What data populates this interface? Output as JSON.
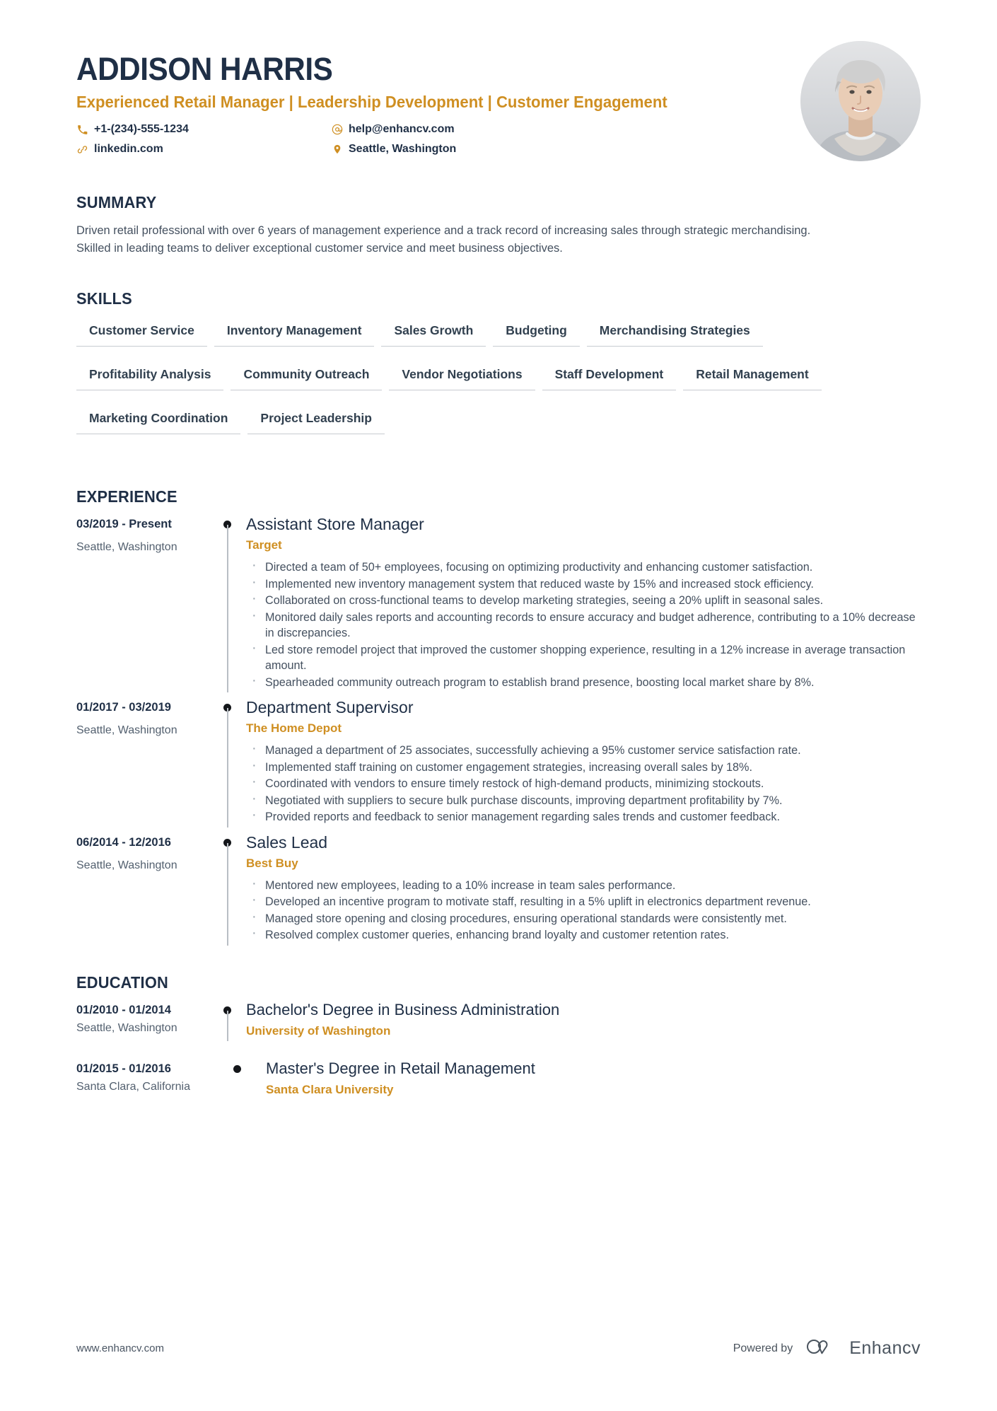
{
  "header": {
    "name": "ADDISON HARRIS",
    "headline": "Experienced Retail Manager | Leadership Development | Customer Engagement",
    "contacts": [
      {
        "icon": "phone-icon",
        "value": "+1-(234)-555-1234"
      },
      {
        "icon": "email-icon",
        "value": "help@enhancv.com"
      },
      {
        "icon": "link-icon",
        "value": "linkedin.com"
      },
      {
        "icon": "location-icon",
        "value": "Seattle, Washington"
      }
    ]
  },
  "summary": {
    "title": "SUMMARY",
    "text": "Driven retail professional with over 6 years of management experience and a track record of increasing sales through strategic merchandising. Skilled in leading teams to deliver exceptional customer service and meet business objectives."
  },
  "skills": {
    "title": "SKILLS",
    "items": [
      "Customer Service",
      "Inventory Management",
      "Sales Growth",
      "Budgeting",
      "Merchandising Strategies",
      "Profitability Analysis",
      "Community Outreach",
      "Vendor Negotiations",
      "Staff Development",
      "Retail Management",
      "Marketing Coordination",
      "Project Leadership"
    ]
  },
  "experience": {
    "title": "EXPERIENCE",
    "entries": [
      {
        "date": "03/2019 - Present",
        "location": "Seattle, Washington",
        "title": "Assistant Store Manager",
        "company": "Target",
        "bullets": [
          "Directed a team of 50+ employees, focusing on optimizing productivity and enhancing customer satisfaction.",
          "Implemented new inventory management system that reduced waste by 15% and increased stock efficiency.",
          "Collaborated on cross-functional teams to develop marketing strategies, seeing a 20% uplift in seasonal sales.",
          "Monitored daily sales reports and accounting records to ensure accuracy and budget adherence, contributing to a 10% decrease in discrepancies.",
          "Led store remodel project that improved the customer shopping experience, resulting in a 12% increase in average transaction amount.",
          "Spearheaded community outreach program to establish brand presence, boosting local market share by 8%."
        ]
      },
      {
        "date": "01/2017 - 03/2019",
        "location": "Seattle, Washington",
        "title": "Department Supervisor",
        "company": "The Home Depot",
        "bullets": [
          "Managed a department of 25 associates, successfully achieving a 95% customer service satisfaction rate.",
          "Implemented staff training on customer engagement strategies, increasing overall sales by 18%.",
          "Coordinated with vendors to ensure timely restock of high-demand products, minimizing stockouts.",
          "Negotiated with suppliers to secure bulk purchase discounts, improving department profitability by 7%.",
          "Provided reports and feedback to senior management regarding sales trends and customer feedback."
        ]
      },
      {
        "date": "06/2014 - 12/2016",
        "location": "Seattle, Washington",
        "title": "Sales Lead",
        "company": "Best Buy",
        "bullets": [
          "Mentored new employees, leading to a 10% increase in team sales performance.",
          "Developed an incentive program to motivate staff, resulting in a 5% uplift in electronics department revenue.",
          "Managed store opening and closing procedures, ensuring operational standards were consistently met.",
          "Resolved complex customer queries, enhancing brand loyalty and customer retention rates."
        ]
      }
    ]
  },
  "education": {
    "title": "EDUCATION",
    "entries": [
      {
        "date": "01/2010 - 01/2014",
        "location": "Seattle, Washington",
        "title": "Bachelor's Degree in Business Administration",
        "school": "University of Washington"
      },
      {
        "date": "01/2015 - 01/2016",
        "location": "Santa Clara, California",
        "title": "Master's Degree in Retail Management",
        "school": "Santa Clara University"
      }
    ]
  },
  "footer": {
    "url": "www.enhancv.com",
    "powered_by": "Powered by",
    "brand": "Enhancv"
  },
  "colors": {
    "navy": "#1f2f46",
    "accent": "#cf8f22",
    "body": "#44505f",
    "rule": "#c7cbd0"
  }
}
